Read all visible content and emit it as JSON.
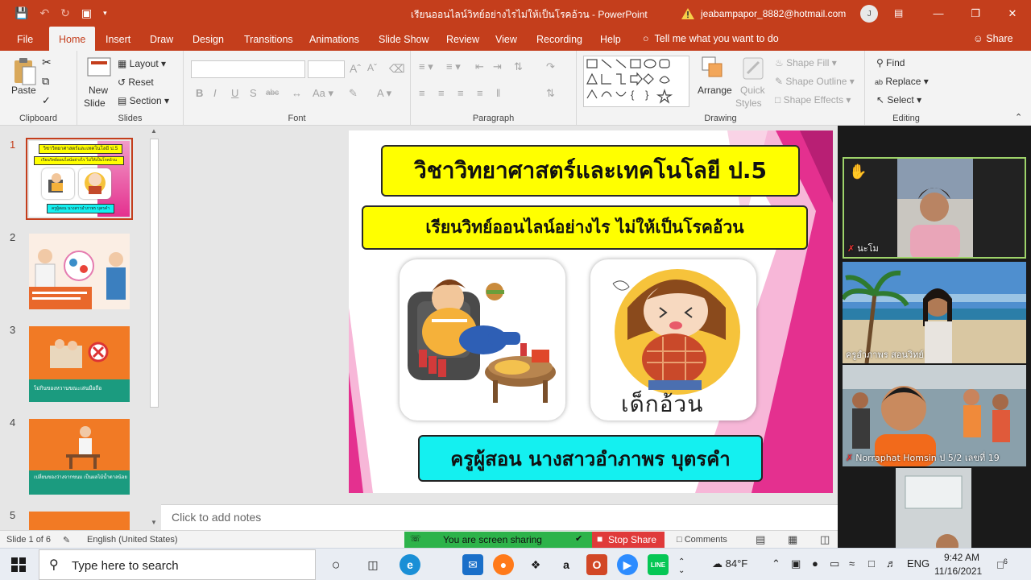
{
  "window": {
    "title": "เรียนออนไลน์วิทย์อย่างไรไม่ให้เป็นโรคอ้วน - PowerPoint",
    "account_email": "jeabampapor_8882@hotmail.com",
    "account_initial": "J"
  },
  "tabs": [
    "File",
    "Home",
    "Insert",
    "Draw",
    "Design",
    "Transitions",
    "Animations",
    "Slide Show",
    "Review",
    "View",
    "Recording",
    "Help"
  ],
  "tell_me": "Tell me what you want to do",
  "share_label": "Share",
  "ribbon": {
    "clipboard": {
      "paste": "Paste",
      "label": "Clipboard"
    },
    "slides": {
      "new_slide_1": "New",
      "new_slide_2": "Slide",
      "layout": "Layout",
      "reset": "Reset",
      "section": "Section",
      "label": "Slides"
    },
    "font": {
      "label": "Font"
    },
    "paragraph": {
      "label": "Paragraph"
    },
    "drawing": {
      "arrange": "Arrange",
      "quick_styles_1": "Quick",
      "quick_styles_2": "Styles",
      "shape_fill": "Shape Fill",
      "shape_outline": "Shape Outline",
      "shape_effects": "Shape Effects",
      "label": "Drawing"
    },
    "editing": {
      "find": "Find",
      "replace": "Replace",
      "select": "Select",
      "label": "Editing"
    }
  },
  "thumbnails": {
    "numbers": [
      "1",
      "2",
      "3",
      "4",
      "5"
    ],
    "t1_title": "วิชาวิทยาศาสตร์และเทคโนโลยี ป.5",
    "t1_sub": "เรียนวิทย์ออนไลน์อย่างไร ไม่ให้เป็นโรคอ้วน",
    "t1_teacher": "ครูผู้สอน นางสาวอำภาพร บุตรคำ",
    "t3_caption": "ไม่กินของหวานขณะเล่นมือถือ",
    "t4_caption": "เปลี่ยนของว่างจากขนม เป็นผลไม้น้ำตาลน้อย"
  },
  "slide": {
    "title": "วิชาวิทยาศาสตร์และเทคโนโลยี ป.5",
    "subtitle": "เรียนวิทย์ออนไลน์อย่างไร ไม่ให้เป็นโรคอ้วน",
    "image_caption": "เด็กอ้วน",
    "teacher": "ครูผู้สอน นางสาวอำภาพร  บุตรคำ"
  },
  "notes_placeholder": "Click to add notes",
  "video_participants": [
    {
      "name": "นะโม"
    },
    {
      "name": "ครูอำภาพร สอนวิทย์"
    },
    {
      "name": "Norraphat Homsin ป 5/2 เลขที่ 19"
    },
    {
      "name": ""
    }
  ],
  "statusbar": {
    "slide_counter": "Slide 1 of 6",
    "language": "English (United States)",
    "sharing_text": "You are screen sharing",
    "stop_share": "Stop Share",
    "comments": "Comments"
  },
  "taskbar": {
    "search_placeholder": "Type here to search",
    "weather": "84°F",
    "lang": "ENG",
    "time": "9:42 AM",
    "date": "11/16/2021",
    "notification_count": "6"
  },
  "colors": {
    "accent": "#c43e1c",
    "banner_yellow": "#ffff00",
    "banner_cyan": "#14f0f0",
    "slide_pink": "#e4308f",
    "sharing_green": "#2db34a",
    "stop_red": "#e03a3a"
  }
}
